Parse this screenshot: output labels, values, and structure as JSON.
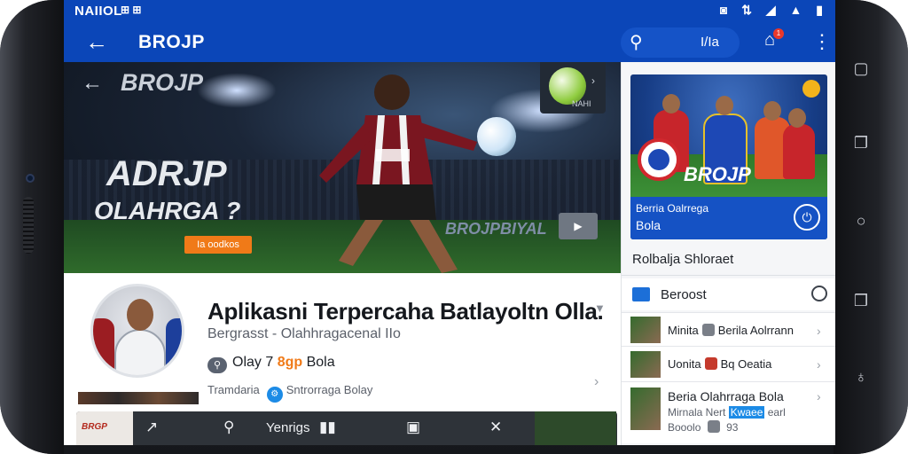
{
  "status_bar": {
    "carrier": "NAIIOL",
    "left_icons": "⊞ ⊞",
    "right_icons": "◙ ⇅ ◢ ▲ ▮"
  },
  "app_bar": {
    "back_icon": "arrow-left-icon",
    "title": "BROJP",
    "search_text": "I/Ia",
    "notification_count": "1"
  },
  "hero": {
    "logo": "BROJP",
    "headline_1": "ADRJP",
    "headline_2": "OLAHRGA ?",
    "badge": "Ia oodkos",
    "banner": "BROJPBIYAL",
    "card_text": "NAHI"
  },
  "app_info": {
    "title": "Aplikasni Terpercaha Batlayoltn Olla.",
    "subtitle": "Bergrasst - Olahhragacenal IIo",
    "rating_prefix": "Olay 7",
    "rating_accent": "8gp",
    "rating_suffix": "Bola",
    "meta_left": "Tramdaria",
    "meta_right": "Sntrorraga Bolay"
  },
  "bottom_bar": {
    "thumb_label": "BRGP",
    "label": "Yenrigs"
  },
  "side_panel": {
    "promo_title": "BROJP",
    "promo_strip_line1": "Berria Oalrrega",
    "promo_strip_line2": "Bola",
    "section_heading": "Rolbalja Shloraet",
    "row_head_label": "Beroost",
    "items": [
      {
        "title_a": "Minita",
        "title_b": "Berila Aolrrann"
      },
      {
        "title_a": "Uonita",
        "title_b": "Bq Oeatia"
      },
      {
        "title_a": "Beria Olahrraga Bola",
        "line2_a": "Mirnala Nert",
        "line2_blue": "Kwaee",
        "line2_b": "earl",
        "line3": "Booolo",
        "line3_num": "93"
      }
    ]
  },
  "colors": {
    "brand_blue": "#0b46b8",
    "accent_orange": "#f07a18"
  }
}
